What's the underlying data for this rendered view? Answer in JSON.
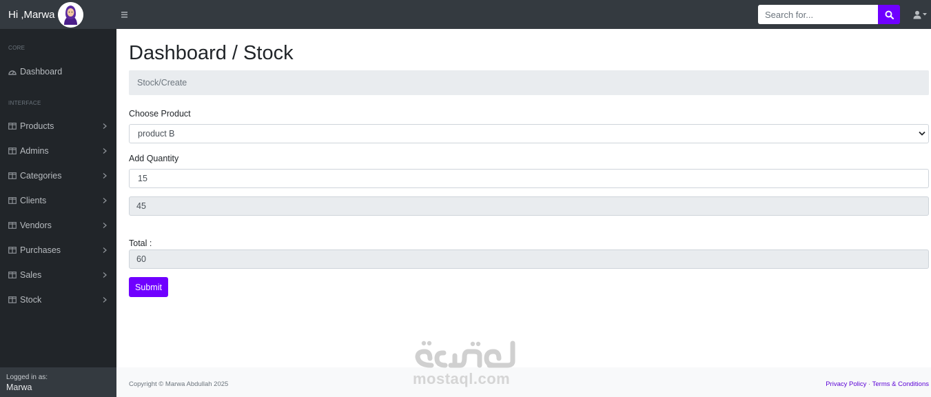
{
  "topbar": {
    "greeting": "Hi ,Marwa",
    "search_placeholder": "Search for...",
    "icons": {
      "avatar": "avatar-hijab",
      "toggle": "bars-icon",
      "search": "search-icon",
      "user": "user-icon"
    }
  },
  "sidebar": {
    "core_heading": "CORE",
    "dashboard_label": "Dashboard",
    "interface_heading": "INTERFACE",
    "items": [
      {
        "label": "Products"
      },
      {
        "label": "Admins"
      },
      {
        "label": "Categories"
      },
      {
        "label": "Clients"
      },
      {
        "label": "Vendors"
      },
      {
        "label": "Purchases"
      },
      {
        "label": "Sales"
      },
      {
        "label": "Stock"
      }
    ],
    "footer": {
      "logged_in_as": "Logged in as:",
      "user": "Marwa"
    }
  },
  "main": {
    "title": "Dashboard / Stock",
    "breadcrumb": "Stock/Create",
    "product_label": "Choose Product",
    "product_value": "product B",
    "quantity_label": "Add Quantity",
    "quantity_value": "15",
    "current_stock_value": "45",
    "total_label": "Total :",
    "total_value": "60",
    "submit_label": "Submit"
  },
  "footer": {
    "copyright": "Copyright © Marwa Abdullah 2025",
    "privacy": "Privacy Policy",
    "separator": "·",
    "terms": "Terms & Conditions"
  },
  "watermark": {
    "arabic": "مستقل",
    "latin": "mostaql.com"
  },
  "colors": {
    "accent": "#6f00ff",
    "navbar": "#343a40",
    "sidebar": "#212529",
    "readonly_field": "#e9ecef"
  }
}
